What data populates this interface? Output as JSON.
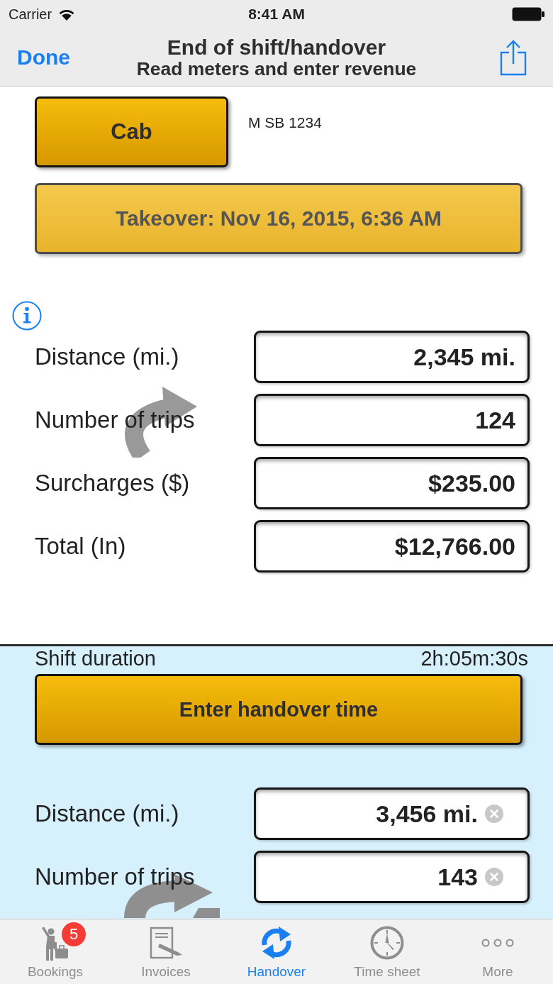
{
  "status_bar": {
    "carrier": "Carrier",
    "time": "8:41 AM"
  },
  "nav_bar": {
    "done_button": "Done",
    "title": "End of shift/handover",
    "subtitle": "Read meters and enter revenue"
  },
  "takeover": {
    "vehicle_button": "Cab",
    "vehicle_plate": "M SB 1234",
    "time_button": "Takeover: Nov 16, 2015, 6:36 AM",
    "fields": [
      {
        "label": "Distance (mi.)",
        "value": "2,345 mi.",
        "clearable": false
      },
      {
        "label": "Number of trips",
        "value": "124",
        "clearable": false
      },
      {
        "label": "Surcharges ($)",
        "value": "$235.00",
        "clearable": false
      },
      {
        "label": "Total (In)",
        "value": "$12,766.00",
        "clearable": false
      }
    ]
  },
  "handover": {
    "duration_label": "Shift duration",
    "duration": "2h:05m:30s",
    "time_button": "Enter handover time",
    "fields": [
      {
        "label": "Distance (mi.)",
        "value": "3,456 mi.",
        "clearable": true
      },
      {
        "label": "Number of trips",
        "value": "143",
        "clearable": true
      }
    ]
  },
  "tab_bar": {
    "tabs": [
      {
        "label": "Bookings",
        "selected": false,
        "badge": "5"
      },
      {
        "label": "Invoices",
        "selected": false
      },
      {
        "label": "Handover",
        "selected": true
      },
      {
        "label": "Time sheet",
        "selected": false
      },
      {
        "label": "More",
        "selected": false
      }
    ]
  }
}
